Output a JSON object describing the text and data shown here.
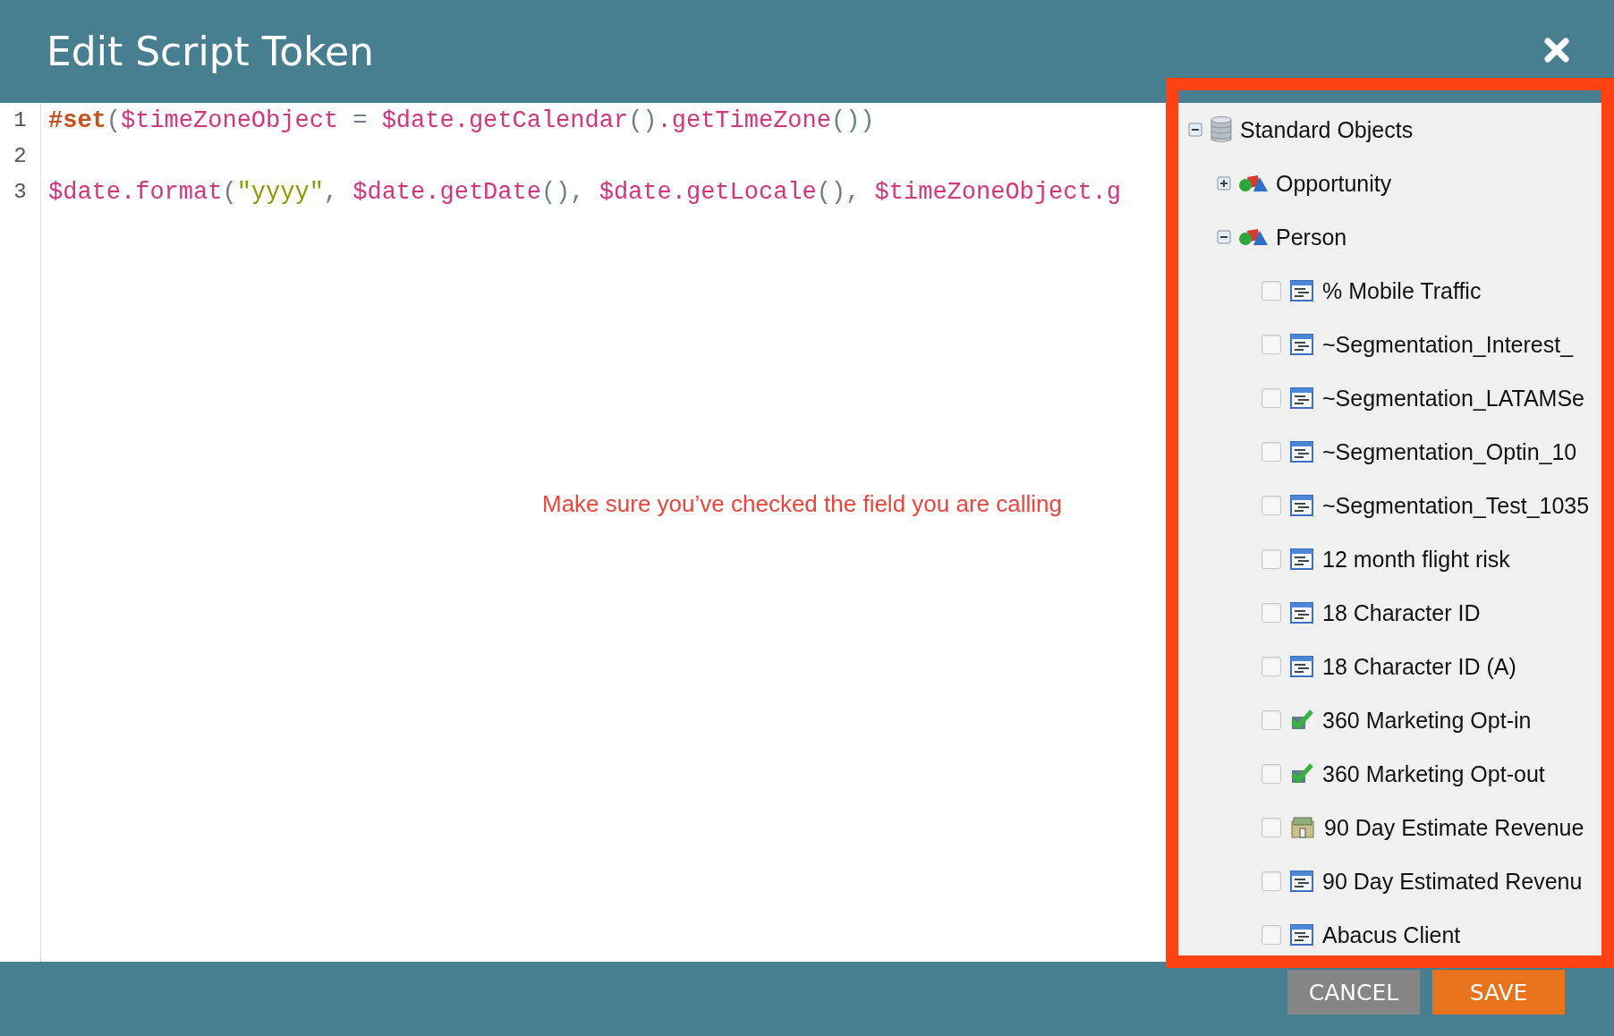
{
  "dialog": {
    "title": "Edit Script Token"
  },
  "editor": {
    "lines": [
      {
        "number": "1",
        "tokens": [
          {
            "kind": "directive",
            "text": "#set"
          },
          {
            "kind": "punct",
            "text": "("
          },
          {
            "kind": "variable",
            "text": "$timeZoneObject"
          },
          {
            "kind": "punct",
            "text": " = "
          },
          {
            "kind": "variable",
            "text": "$date.getCalendar"
          },
          {
            "kind": "punct",
            "text": "()"
          },
          {
            "kind": "variable",
            "text": ".getTimeZone"
          },
          {
            "kind": "punct",
            "text": "())"
          }
        ]
      },
      {
        "number": "2"
      },
      {
        "number": "3",
        "tokens": [
          {
            "kind": "variable",
            "text": "$date.format"
          },
          {
            "kind": "punct",
            "text": "("
          },
          {
            "kind": "string",
            "text": "\"yyyy\""
          },
          {
            "kind": "punct",
            "text": ", "
          },
          {
            "kind": "variable",
            "text": "$date.getDate"
          },
          {
            "kind": "punct",
            "text": "(), "
          },
          {
            "kind": "variable",
            "text": "$date.getLocale"
          },
          {
            "kind": "punct",
            "text": "(), "
          },
          {
            "kind": "variable",
            "text": "$timeZoneObject.g"
          }
        ]
      }
    ],
    "note": "Make sure you’ve checked the field you are calling"
  },
  "tree": {
    "label": "Standard Objects",
    "kind": "database",
    "expanded": true,
    "children": [
      {
        "label": "Opportunity",
        "kind": "object",
        "expanded": false
      },
      {
        "label": "Person",
        "kind": "object",
        "expanded": true,
        "children": [
          {
            "label": "% Mobile Traffic",
            "kind": "text",
            "checked": false
          },
          {
            "label": "~Segmentation_Interest_",
            "kind": "text",
            "checked": false
          },
          {
            "label": "~Segmentation_LATAMSe",
            "kind": "text",
            "checked": false
          },
          {
            "label": "~Segmentation_Optin_10",
            "kind": "text",
            "checked": false
          },
          {
            "label": "~Segmentation_Test_1035",
            "kind": "text",
            "checked": false
          },
          {
            "label": "12 month flight risk",
            "kind": "text",
            "checked": false
          },
          {
            "label": "18 Character ID",
            "kind": "text",
            "checked": false
          },
          {
            "label": "18 Character ID (A)",
            "kind": "text",
            "checked": false
          },
          {
            "label": "360 Marketing Opt-in",
            "kind": "boolean",
            "checked": false
          },
          {
            "label": "360 Marketing Opt-out",
            "kind": "boolean",
            "checked": false
          },
          {
            "label": "90 Day Estimate Revenue",
            "kind": "currency",
            "checked": false
          },
          {
            "label": "90 Day Estimated Revenu",
            "kind": "text",
            "checked": false
          },
          {
            "label": "Abacus Client",
            "kind": "text",
            "checked": false
          }
        ]
      }
    ]
  },
  "buttons": [
    {
      "label": "CANCEL",
      "kind": "secondary"
    },
    {
      "label": "SAVE",
      "kind": "primary"
    }
  ]
}
